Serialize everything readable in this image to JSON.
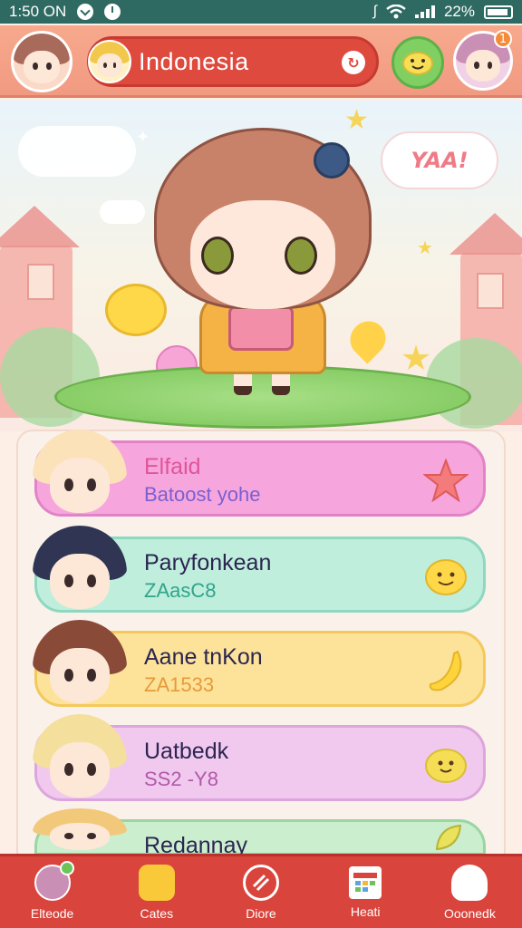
{
  "status_bar": {
    "time": "1:50 ON",
    "battery": "22%"
  },
  "header": {
    "title": "Indonesia",
    "badge": "1",
    "colors": {
      "bar": "#f19a82",
      "search": "#df4a3e",
      "accent_green": "#7fcf62"
    }
  },
  "scene": {
    "speech_bubble": "YAA!"
  },
  "contacts": [
    {
      "name": "Elfaid",
      "subtitle": "Batoost yohe",
      "name_color": "#e0559a",
      "sub_color": "#7b5fd1",
      "bg": "#f6a6dc",
      "border": "#e184c7",
      "icon": "star-icon"
    },
    {
      "name": "Paryfonkean",
      "subtitle": "ZAasC8",
      "name_color": "#2b2550",
      "sub_color": "#30a48a",
      "bg": "#bfeedd",
      "border": "#8fd8c0",
      "icon": "smiley-icon"
    },
    {
      "name": "Aane tnKon",
      "subtitle": "ZA1533",
      "name_color": "#2b2550",
      "sub_color": "#e79a3a",
      "bg": "#fde39a",
      "border": "#f3c95c",
      "icon": "banana-icon"
    },
    {
      "name": "Uatbedk",
      "subtitle": "SS2 -Y8",
      "name_color": "#2b2550",
      "sub_color": "#b05aa8",
      "bg": "#f1c9ef",
      "border": "#dca6dc",
      "icon": "lemon-icon"
    },
    {
      "name": "Redannay",
      "subtitle": "",
      "name_color": "#2b2550",
      "sub_color": "#2b2550",
      "bg": "#cbeecf",
      "border": "#9ad6a2",
      "icon": "leaf-icon"
    }
  ],
  "bottom_nav": [
    {
      "label": "Elteode",
      "icon": "profile-icon"
    },
    {
      "label": "Cates",
      "icon": "gift-icon"
    },
    {
      "label": "Diore",
      "icon": "spiral-icon"
    },
    {
      "label": "Heati",
      "icon": "grid-icon"
    },
    {
      "label": "Ooonedk",
      "icon": "ghost-icon"
    }
  ]
}
